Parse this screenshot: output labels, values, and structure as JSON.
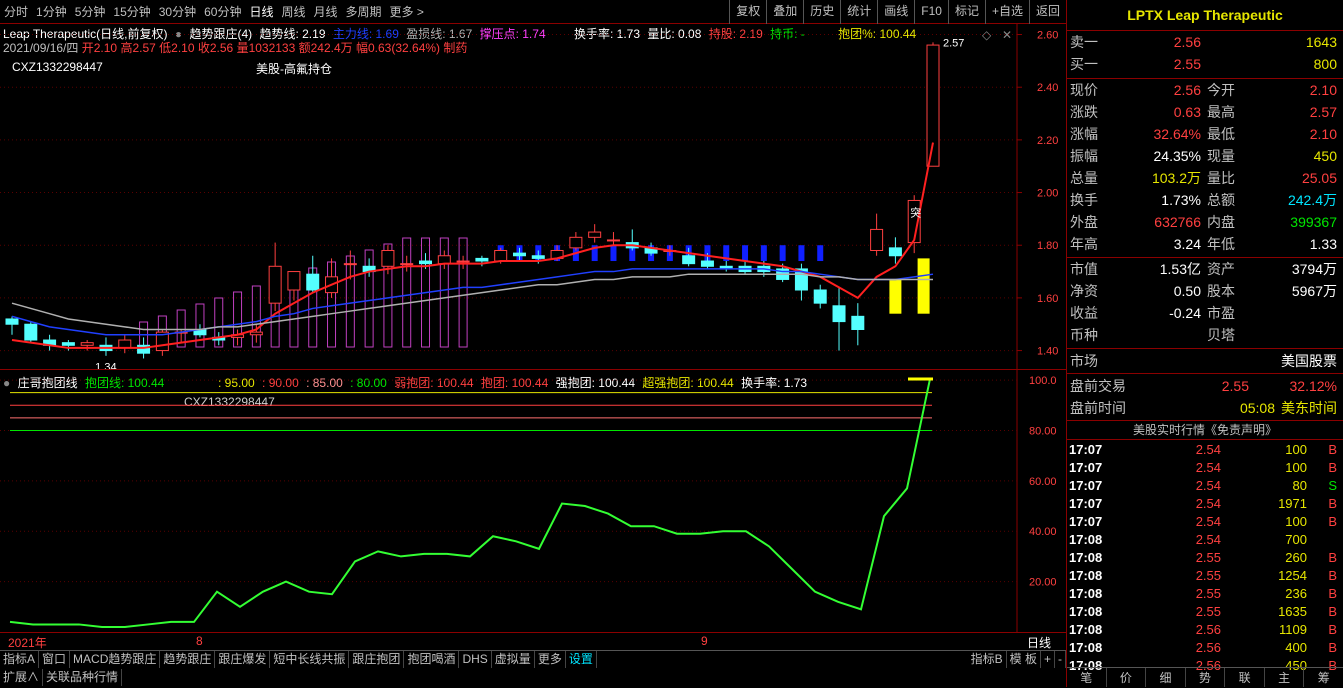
{
  "toolbar": {
    "periods": [
      "分时",
      "1分钟",
      "5分钟",
      "15分钟",
      "30分钟",
      "60分钟",
      "日线",
      "周线",
      "月线",
      "多周期",
      "更多 >"
    ],
    "active": "日线",
    "right": [
      "复权",
      "叠加",
      "历史",
      "统计",
      "画线",
      "F10",
      "标记",
      "+自选",
      "返回"
    ]
  },
  "info": {
    "title": "Leap Therapeutic(日线,前复权)",
    "indicator": "趋势跟庄(4)",
    "trend_label": "趋势线: 2.19",
    "main_label": "主力线: 1.69",
    "profit_label": "盈损线: 1.67",
    "support_label": "撑压点: 1.74",
    "turnover": "换手率: 1.73",
    "vol_ratio": "量比: 0.08",
    "hold": "持股: 2.19",
    "hold_coin": "持币: -",
    "hug_pct": "抱团%: 100.44",
    "date": "2021/09/16/四",
    "open": "开2.10",
    "high": "高2.57",
    "low": "低2.10",
    "close": "收2.56",
    "volume": "量1032133",
    "amount": "额242.4万",
    "amp": "幅0.63(32.64%)",
    "sector": "制药",
    "code": "CXZ1332298447",
    "note": "美股-高氟持仓",
    "max_label": "2.57",
    "min_label": "1.34",
    "tu": "突"
  },
  "main_axis": [
    "2.60",
    "2.40",
    "2.20",
    "2.00",
    "1.80",
    "1.60",
    "1.40"
  ],
  "sub_info": {
    "name": "庄哥抱团线",
    "hug_line": "抱团线: 100.44",
    "l95": ": 95.00",
    "l90": ": 90.00",
    "l85": ": 85.00",
    "l80": ": 80.00",
    "weak": "弱抱团: 100.44",
    "hug": "抱团: 100.44",
    "strong": "强抱团: 100.44",
    "super": "超强抱团: 100.44",
    "turnover": "换手率: 1.73",
    "code": "CXZ1332298447"
  },
  "sub_axis": [
    "100.0",
    "80.00",
    "60.00",
    "40.00",
    "20.00"
  ],
  "date_axis": [
    "2021年",
    "8",
    "9"
  ],
  "period_tag": "日线",
  "bottom_tabs": [
    "指标A",
    "窗口",
    "MACD趋势跟庄",
    "趋势跟庄",
    "跟庄爆发",
    "短中长线共振",
    "跟庄抱团",
    "抱团喝酒",
    "DHS",
    "虚拟量",
    "更多",
    "设置"
  ],
  "bottom_right": [
    "指标B",
    "模 板",
    "+",
    "-"
  ],
  "bottom2": [
    "扩展∧",
    "关联品种行情"
  ],
  "right_panel": {
    "title": "LPTX Leap Therapeutic",
    "sell1": {
      "label": "卖一",
      "price": "2.56",
      "vol": "1643"
    },
    "buy1": {
      "label": "买一",
      "price": "2.55",
      "vol": "800"
    },
    "stats": [
      {
        "l1": "现价",
        "v1": "2.56",
        "c1": "red",
        "l2": "今开",
        "v2": "2.10",
        "c2": "red"
      },
      {
        "l1": "涨跌",
        "v1": "0.63",
        "c1": "red",
        "l2": "最高",
        "v2": "2.57",
        "c2": "red"
      },
      {
        "l1": "涨幅",
        "v1": "32.64%",
        "c1": "red",
        "l2": "最低",
        "v2": "2.10",
        "c2": "red"
      },
      {
        "l1": "振幅",
        "v1": "24.35%",
        "c1": "white",
        "l2": "现量",
        "v2": "450",
        "c2": "yellow"
      },
      {
        "l1": "总量",
        "v1": "103.2万",
        "c1": "yellow",
        "l2": "量比",
        "v2": "25.05",
        "c2": "red"
      },
      {
        "l1": "换手",
        "v1": "1.73%",
        "c1": "white",
        "l2": "总额",
        "v2": "242.4万",
        "c2": "cyan"
      },
      {
        "l1": "外盘",
        "v1": "632766",
        "c1": "red",
        "l2": "内盘",
        "v2": "399367",
        "c2": "green"
      },
      {
        "l1": "年高",
        "v1": "3.24",
        "c1": "white",
        "l2": "年低",
        "v2": "1.33",
        "c2": "white"
      }
    ],
    "fin": [
      {
        "l1": "市值",
        "v1": "1.53亿",
        "l2": "资产",
        "v2": "3794万"
      },
      {
        "l1": "净资",
        "v1": "0.50",
        "l2": "股本",
        "v2": "5967万"
      },
      {
        "l1": "收益",
        "v1": "-0.24",
        "l2": "市盈",
        "v2": ""
      },
      {
        "l1": "币种",
        "v1": "",
        "l2": "贝塔",
        "v2": ""
      }
    ],
    "market_label": "市场",
    "market_value": "美国股票",
    "pre_label": "盘前交易",
    "pre_price": "2.55",
    "pre_pct": "32.12%",
    "pre_time_label": "盘前时间",
    "pre_time": "05:08",
    "pre_tz": "美东时间",
    "rt_title": "美股实时行情《免责声明》",
    "ticks": [
      {
        "t": "17:07",
        "p": "2.54",
        "v": "100",
        "s": "B"
      },
      {
        "t": "17:07",
        "p": "2.54",
        "v": "100",
        "s": "B"
      },
      {
        "t": "17:07",
        "p": "2.54",
        "v": "80",
        "s": "S"
      },
      {
        "t": "17:07",
        "p": "2.54",
        "v": "1971",
        "s": "B"
      },
      {
        "t": "17:07",
        "p": "2.54",
        "v": "100",
        "s": "B"
      },
      {
        "t": "17:08",
        "p": "2.54",
        "v": "700",
        "s": ""
      },
      {
        "t": "17:08",
        "p": "2.55",
        "v": "260",
        "s": "B"
      },
      {
        "t": "17:08",
        "p": "2.55",
        "v": "1254",
        "s": "B"
      },
      {
        "t": "17:08",
        "p": "2.55",
        "v": "236",
        "s": "B"
      },
      {
        "t": "17:08",
        "p": "2.55",
        "v": "1635",
        "s": "B"
      },
      {
        "t": "17:08",
        "p": "2.56",
        "v": "1109",
        "s": "B"
      },
      {
        "t": "17:08",
        "p": "2.56",
        "v": "400",
        "s": "B"
      },
      {
        "t": "17:08",
        "p": "2.56",
        "v": "450",
        "s": "B"
      }
    ],
    "bottom_tabs": [
      "笔",
      "价",
      "细",
      "势",
      "联",
      "主",
      "筹"
    ]
  },
  "chart_data": [
    {
      "type": "candlestick",
      "title": "Leap Therapeutic(日线,前复权)",
      "ylim": [
        1.33,
        2.64
      ],
      "y_ticks": [
        1.4,
        1.6,
        1.8,
        2.0,
        2.2,
        2.4,
        2.6
      ],
      "candles": [
        [
          1.52,
          1.53,
          1.46,
          1.5
        ],
        [
          1.5,
          1.51,
          1.43,
          1.44
        ],
        [
          1.44,
          1.46,
          1.4,
          1.42
        ],
        [
          1.43,
          1.44,
          1.4,
          1.42
        ],
        [
          1.42,
          1.44,
          1.4,
          1.43
        ],
        [
          1.42,
          1.45,
          1.38,
          1.4
        ],
        [
          1.41,
          1.46,
          1.39,
          1.44
        ],
        [
          1.42,
          1.45,
          1.37,
          1.39
        ],
        [
          1.4,
          1.48,
          1.38,
          1.47
        ],
        [
          1.47,
          1.48,
          1.43,
          1.47
        ],
        [
          1.48,
          1.5,
          1.45,
          1.46
        ],
        [
          1.45,
          1.47,
          1.42,
          1.44
        ],
        [
          1.45,
          1.48,
          1.42,
          1.46
        ],
        [
          1.46,
          1.5,
          1.43,
          1.47
        ],
        [
          1.58,
          1.81,
          1.55,
          1.72
        ],
        [
          1.63,
          1.7,
          1.59,
          1.7
        ],
        [
          1.69,
          1.76,
          1.62,
          1.63
        ],
        [
          1.62,
          1.75,
          1.6,
          1.68
        ],
        [
          1.73,
          1.78,
          1.67,
          1.73
        ],
        [
          1.72,
          1.75,
          1.68,
          1.7
        ],
        [
          1.72,
          1.8,
          1.69,
          1.78
        ],
        [
          1.73,
          1.76,
          1.7,
          1.73
        ],
        [
          1.74,
          1.77,
          1.71,
          1.73
        ],
        [
          1.73,
          1.78,
          1.71,
          1.76
        ],
        [
          1.74,
          1.76,
          1.71,
          1.74
        ],
        [
          1.75,
          1.76,
          1.72,
          1.74
        ],
        [
          1.74,
          1.79,
          1.73,
          1.78
        ],
        [
          1.77,
          1.79,
          1.74,
          1.76
        ],
        [
          1.76,
          1.78,
          1.73,
          1.75
        ],
        [
          1.75,
          1.8,
          1.74,
          1.78
        ],
        [
          1.79,
          1.85,
          1.78,
          1.83
        ],
        [
          1.83,
          1.88,
          1.81,
          1.85
        ],
        [
          1.82,
          1.85,
          1.8,
          1.82
        ],
        [
          1.81,
          1.86,
          1.78,
          1.79
        ],
        [
          1.79,
          1.81,
          1.76,
          1.77
        ],
        [
          1.78,
          1.8,
          1.76,
          1.78
        ],
        [
          1.76,
          1.79,
          1.72,
          1.73
        ],
        [
          1.74,
          1.77,
          1.71,
          1.72
        ],
        [
          1.72,
          1.74,
          1.7,
          1.71
        ],
        [
          1.72,
          1.74,
          1.69,
          1.7
        ],
        [
          1.72,
          1.74,
          1.68,
          1.7
        ],
        [
          1.71,
          1.73,
          1.66,
          1.67
        ],
        [
          1.71,
          1.73,
          1.59,
          1.63
        ],
        [
          1.63,
          1.65,
          1.56,
          1.58
        ],
        [
          1.57,
          1.64,
          1.4,
          1.51
        ],
        [
          1.53,
          1.58,
          1.42,
          1.48
        ],
        [
          1.78,
          1.92,
          1.76,
          1.86
        ],
        [
          1.79,
          1.83,
          1.73,
          1.76
        ],
        [
          1.81,
          1.99,
          1.77,
          1.97
        ],
        [
          2.1,
          2.57,
          2.1,
          2.56
        ]
      ],
      "lines": [
        {
          "name": "趋势线",
          "color": "#ff2020",
          "values": [
            1.44,
            1.43,
            1.42,
            1.41,
            1.41,
            1.41,
            1.41,
            1.41,
            1.42,
            1.43,
            1.44,
            1.45,
            1.46,
            1.48,
            1.54,
            1.58,
            1.62,
            1.65,
            1.68,
            1.7,
            1.71,
            1.72,
            1.72,
            1.73,
            1.73,
            1.73,
            1.74,
            1.74,
            1.74,
            1.75,
            1.77,
            1.79,
            1.8,
            1.8,
            1.79,
            1.78,
            1.77,
            1.76,
            1.75,
            1.74,
            1.73,
            1.72,
            1.7,
            1.68,
            1.64,
            1.6,
            1.68,
            1.72,
            1.82,
            2.19
          ]
        },
        {
          "name": "主力线",
          "color": "#2040ff",
          "values": [
            1.53,
            1.51,
            1.49,
            1.48,
            1.47,
            1.46,
            1.46,
            1.46,
            1.46,
            1.47,
            1.48,
            1.49,
            1.5,
            1.51,
            1.53,
            1.54,
            1.56,
            1.57,
            1.58,
            1.59,
            1.6,
            1.61,
            1.62,
            1.63,
            1.64,
            1.64,
            1.65,
            1.66,
            1.67,
            1.68,
            1.69,
            1.7,
            1.7,
            1.71,
            1.71,
            1.71,
            1.71,
            1.71,
            1.71,
            1.71,
            1.71,
            1.7,
            1.7,
            1.69,
            1.68,
            1.67,
            1.67,
            1.67,
            1.68,
            1.69
          ]
        },
        {
          "name": "盈损线",
          "color": "#b0b0b0",
          "values": [
            1.58,
            1.56,
            1.54,
            1.52,
            1.51,
            1.5,
            1.49,
            1.48,
            1.48,
            1.48,
            1.48,
            1.49,
            1.49,
            1.5,
            1.51,
            1.52,
            1.53,
            1.54,
            1.55,
            1.56,
            1.57,
            1.58,
            1.59,
            1.6,
            1.61,
            1.62,
            1.63,
            1.64,
            1.65,
            1.65,
            1.66,
            1.67,
            1.67,
            1.68,
            1.68,
            1.68,
            1.69,
            1.69,
            1.69,
            1.69,
            1.69,
            1.69,
            1.69,
            1.68,
            1.68,
            1.67,
            1.67,
            1.67,
            1.67,
            1.67
          ]
        }
      ]
    },
    {
      "type": "line",
      "title": "庄哥抱团线",
      "ylim": [
        0,
        104
      ],
      "y_ticks": [
        20,
        40,
        60,
        80,
        100
      ],
      "ref_lines": [
        {
          "name": "95",
          "value": 95,
          "color": "#e6e600"
        },
        {
          "name": "90",
          "value": 90,
          "color": "#ff4040"
        },
        {
          "name": "85",
          "value": 85,
          "color": "#ff7070"
        },
        {
          "name": "80",
          "value": 80,
          "color": "#00e600"
        }
      ],
      "series": [
        {
          "name": "抱团线",
          "color": "#33ff33",
          "values": [
            4,
            3,
            3,
            3,
            2,
            2,
            3,
            4,
            4,
            16,
            10,
            16,
            20,
            16,
            15,
            28,
            32,
            30,
            31,
            31,
            30,
            38,
            36,
            33,
            51,
            50,
            47,
            42,
            42,
            39,
            39,
            40,
            40,
            34,
            25,
            16,
            12,
            9,
            46,
            57,
            100.44
          ]
        }
      ]
    }
  ]
}
